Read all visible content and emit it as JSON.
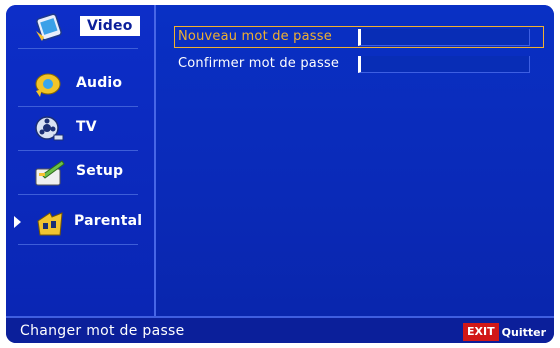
{
  "sidebar": {
    "items": [
      {
        "label": "Video",
        "icon": "video-icon",
        "selected": true,
        "pointer": false
      },
      {
        "label": "Audio",
        "icon": "audio-icon",
        "selected": false,
        "pointer": false
      },
      {
        "label": "TV",
        "icon": "tv-icon",
        "selected": false,
        "pointer": false
      },
      {
        "label": "Setup",
        "icon": "setup-icon",
        "selected": false,
        "pointer": false
      },
      {
        "label": "Parental",
        "icon": "parental-icon",
        "selected": false,
        "pointer": true
      }
    ]
  },
  "main": {
    "fields": [
      {
        "label": "Nouveau mot de passe",
        "value": "",
        "active": true
      },
      {
        "label": "Confirmer mot de passe",
        "value": "",
        "active": false
      }
    ]
  },
  "status": {
    "text": "Changer mot de passe",
    "exit_key": "EXIT",
    "exit_label": "Quitter"
  },
  "colors": {
    "background_blue": "#0c24b2",
    "highlight_gold": "#f0b030",
    "exit_red": "#d11818"
  }
}
